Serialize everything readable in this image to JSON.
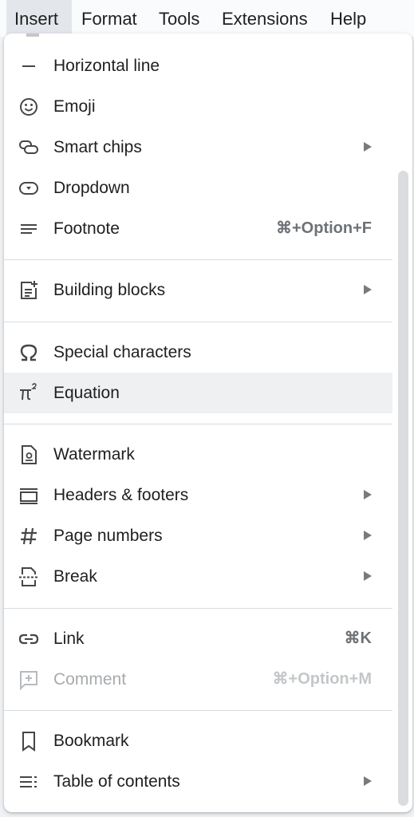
{
  "menubar": {
    "items": [
      "Insert",
      "Format",
      "Tools",
      "Extensions",
      "Help"
    ]
  },
  "menu": {
    "items": [
      {
        "label": "Horizontal line",
        "icon": "horizontal-line-icon"
      },
      {
        "label": "Emoji",
        "icon": "emoji-icon"
      },
      {
        "label": "Smart chips",
        "icon": "smart-chips-icon",
        "submenu": true
      },
      {
        "label": "Dropdown",
        "icon": "dropdown-icon"
      },
      {
        "label": "Footnote",
        "icon": "footnote-icon",
        "shortcut": "⌘+Option+F"
      },
      {
        "label": "Building blocks",
        "icon": "building-blocks-icon",
        "submenu": true
      },
      {
        "label": "Special characters",
        "icon": "omega-icon"
      },
      {
        "label": "Equation",
        "icon": "pi-squared-icon",
        "highlighted": true
      },
      {
        "label": "Watermark",
        "icon": "watermark-icon"
      },
      {
        "label": "Headers & footers",
        "icon": "headers-footers-icon",
        "submenu": true
      },
      {
        "label": "Page numbers",
        "icon": "hash-icon",
        "submenu": true
      },
      {
        "label": "Break",
        "icon": "break-icon",
        "submenu": true
      },
      {
        "label": "Link",
        "icon": "link-icon",
        "shortcut": "⌘K"
      },
      {
        "label": "Comment",
        "icon": "add-comment-icon",
        "shortcut": "⌘+Option+M",
        "disabled": true
      },
      {
        "label": "Bookmark",
        "icon": "bookmark-icon"
      },
      {
        "label": "Table of contents",
        "icon": "table-of-contents-icon",
        "submenu": true
      }
    ]
  },
  "colors": {
    "menu_text": "#1f1f1f",
    "shortcut_text": "#6e7276",
    "disabled_text": "#a8abad",
    "highlight_bg": "#eef0f2",
    "active_menubar_bg": "#e3e7ec"
  }
}
